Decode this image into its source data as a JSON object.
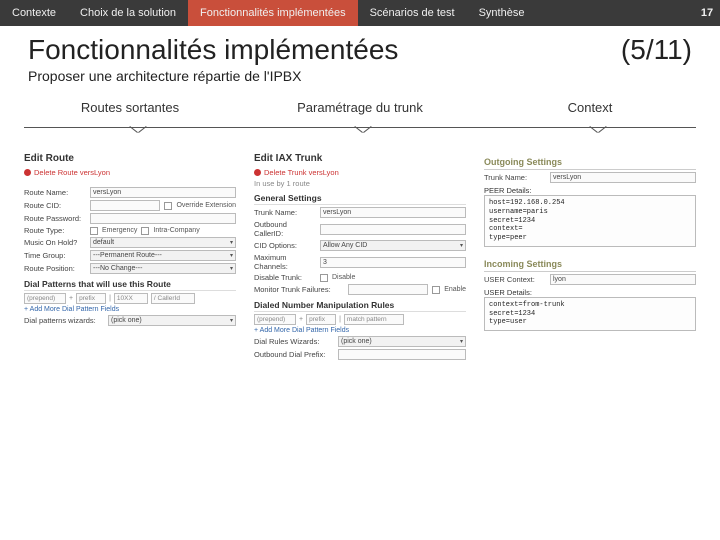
{
  "topbar": {
    "items": [
      {
        "label": "Contexte"
      },
      {
        "label": "Choix de la solution"
      },
      {
        "label": "Fonctionnalités implémentées",
        "active": true
      },
      {
        "label": "Scénarios de test"
      },
      {
        "label": "Synthèse"
      }
    ],
    "page": "17"
  },
  "title": "Fonctionnalités implémentées",
  "counter": "(5/11)",
  "subtitle": "Proposer une architecture répartie de l'IPBX",
  "columns": {
    "routes": {
      "label": "Routes sortantes"
    },
    "trunk": {
      "label": "Paramétrage du trunk"
    },
    "context": {
      "label": "Context"
    }
  },
  "routes_panel": {
    "head": "Edit Route",
    "del": "Delete Route versLyon",
    "rows": {
      "route_name_lab": "Route Name:",
      "route_name_val": "versLyon",
      "route_cid_lab": "Route CID:",
      "route_cid_val": "",
      "override_lab": "Override Extension",
      "route_pw_lab": "Route Password:",
      "route_pw_val": "",
      "route_type_lab": "Route Type:",
      "emergency_lab": "Emergency",
      "intra_lab": "Intra-Company",
      "moh_lab": "Music On Hold?",
      "moh_val": "default",
      "time_group_lab": "Time Group:",
      "time_group_val": "---Permanent Route---",
      "route_pos_lab": "Route Position:",
      "route_pos_val": "---No Change---"
    },
    "dialpatterns": {
      "head": "Dial Patterns that will use this Route",
      "prepend": "(prepend)",
      "prefix": "prefix",
      "pattern": "10XX",
      "callerid": "/ CallerId",
      "addmore": "+ Add More Dial Pattern Fields",
      "wiz_lab": "Dial patterns wizards:",
      "wiz_val": "(pick one)"
    }
  },
  "trunk_panel": {
    "head": "Edit IAX Trunk",
    "del": "Delete Trunk versLyon",
    "inuse": "In use by 1 route",
    "general": "General Settings",
    "rows": {
      "tn_lab": "Trunk Name:",
      "tn_val": "versLyon",
      "ocid_lab": "Outbound CallerID:",
      "ocid_val": "",
      "cidopt_lab": "CID Options:",
      "cidopt_val": "Allow Any CID",
      "maxch_lab": "Maximum Channels:",
      "maxch_val": "3",
      "dis_lab": "Disable Trunk:",
      "dis_chk": "Disable",
      "mon_lab": "Monitor Trunk Failures:",
      "mon_chk": "Enable"
    },
    "manip": {
      "head": "Dialed Number Manipulation Rules",
      "prepend": "(prepend)",
      "prefix": "prefix",
      "pattern": "match pattern",
      "addmore": "+ Add More Dial Pattern Fields",
      "wiz_lab": "Dial Rules Wizards:",
      "wiz_val": "(pick one)",
      "odp_lab": "Outbound Dial Prefix:",
      "odp_val": ""
    }
  },
  "context_panel": {
    "outgoing_head": "Outgoing Settings",
    "out_tn_lab": "Trunk Name:",
    "out_tn_val": "versLyon",
    "peer_lab": "PEER Details:",
    "peer_code": "host=192.168.0.254\nusername=paris\nsecret=1234\ncontext=\ntype=peer",
    "incoming_head": "Incoming Settings",
    "in_ctx_lab": "USER Context:",
    "in_ctx_val": "lyon",
    "user_lab": "USER Details:",
    "user_code": "context=from-trunk\nsecret=1234\ntype=user"
  }
}
